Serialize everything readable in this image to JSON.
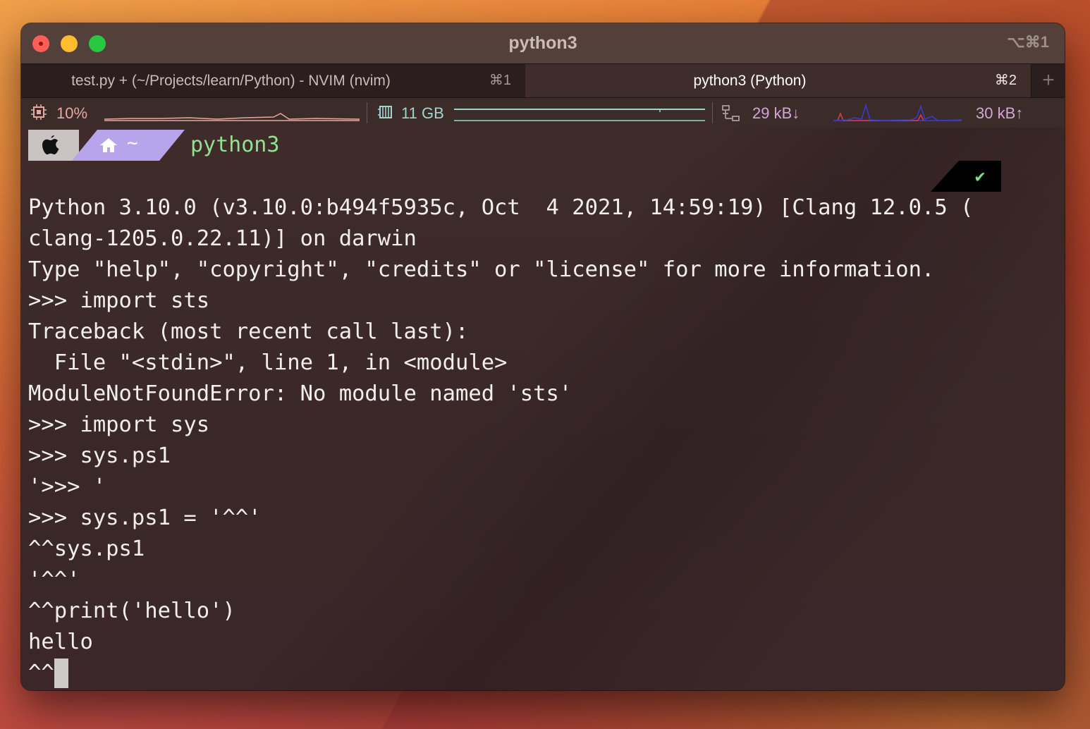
{
  "window": {
    "title": "python3",
    "title_shortcut": "⌥⌘1"
  },
  "tabs": [
    {
      "label": "test.py + (~/Projects/learn/Python) - NVIM (nvim)",
      "shortcut": "⌘1"
    },
    {
      "label": "python3 (Python)",
      "shortcut": "⌘2"
    }
  ],
  "tab_add_label": "+",
  "status": {
    "cpu": "10%",
    "memory": "11 GB",
    "net_down": "29 kB↓",
    "net_up": "30 kB↑"
  },
  "prompt": {
    "home_symbol": "~",
    "path": "python3",
    "status_mark": "✔"
  },
  "terminal_lines": [
    "Python 3.10.0 (v3.10.0:b494f5935c, Oct  4 2021, 14:59:19) [Clang 12.0.5 (",
    "clang-1205.0.22.11)] on darwin",
    "Type \"help\", \"copyright\", \"credits\" or \"license\" for more information.",
    ">>> import sts",
    "Traceback (most recent call last):",
    "  File \"<stdin>\", line 1, in <module>",
    "ModuleNotFoundError: No module named 'sts'",
    ">>> import sys",
    ">>> sys.ps1",
    "'>>> '",
    ">>> sys.ps1 = '^^'",
    "^^sys.ps1",
    "'^^'",
    "^^print('hello')",
    "hello"
  ],
  "current_prompt": "^^",
  "colors": {
    "prompt_path": "#8fe38f",
    "cpu": "#e6a8a0",
    "memory": "#9fd5cf",
    "network": "#d2a6d6",
    "status_ok": "#7ee07e"
  }
}
